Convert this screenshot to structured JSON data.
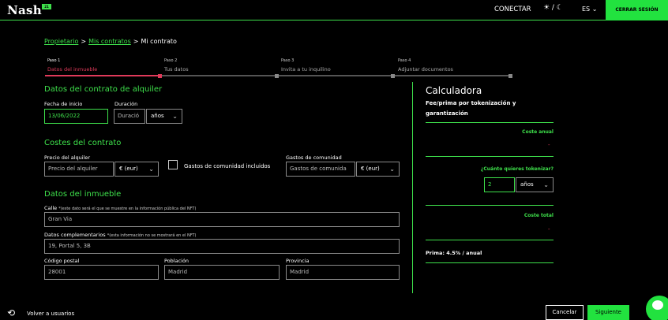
{
  "header": {
    "logo": "Nash",
    "logo_badge": "21",
    "connect": "CONECTAR",
    "theme_toggle": "☀ / ☾",
    "language": "ES",
    "logout": "CERRAR SESIÓN"
  },
  "breadcrumb": {
    "items": [
      "Propietario",
      "Mis contratos"
    ],
    "separator": ">",
    "current": "Mi contrato"
  },
  "steps": [
    {
      "num": "Paso 1",
      "label": "Datos del inmueble"
    },
    {
      "num": "Paso 2",
      "label": "Tus datos"
    },
    {
      "num": "Paso 3",
      "label": "Invita a tu inquilino"
    },
    {
      "num": "Paso 4",
      "label": "Adjuntar documentos"
    }
  ],
  "rental": {
    "title": "Datos del contrato de alquiler",
    "start_label": "Fecha de inicio",
    "start_value": "13/06/2022",
    "duration_label": "Duración",
    "duration_placeholder": "Duració",
    "duration_unit": "años"
  },
  "costs": {
    "title": "Costes del contrato",
    "rent_label": "Precio del alquiler",
    "rent_placeholder": "Precio del alquiler",
    "rent_currency": "€ (eur)",
    "community_included": "Gastos de comunidad incluidos",
    "community_label": "Gastos de comunidad",
    "community_placeholder": "Gastos de comunida",
    "community_currency": "€ (eur)"
  },
  "property": {
    "title": "Datos del inmueble",
    "street_label": "Calle",
    "street_note": "*(este dato será el que se muestre en la información pública del NFT)",
    "street_value": "Gran Via",
    "extra_label": "Datos complementarios",
    "extra_note": "*(esta información no se mostrará en el NFT)",
    "extra_value": "19, Portal 5, 3B",
    "postal_label": "Código postal",
    "postal_value": "28001",
    "city_label": "Población",
    "city_value": "Madrid",
    "province_label": "Provincia",
    "province_value": "Madrid"
  },
  "calculator": {
    "title": "Calculadora",
    "subtitle": "Fee/prima por tokenización y garantización",
    "annual_cost_label": "Coste anual",
    "annual_cost_value": "-",
    "tokenize_label": "¿Cuánto quieres tokenizar?",
    "tokenize_value": "2",
    "tokenize_unit": "años",
    "total_cost_label": "Coste total",
    "total_cost_value": "-",
    "prima": "Prima: 4.5% / anual"
  },
  "footer": {
    "back": "Volver a usuarios",
    "cancel": "Cancelar",
    "next": "Siguiente"
  }
}
